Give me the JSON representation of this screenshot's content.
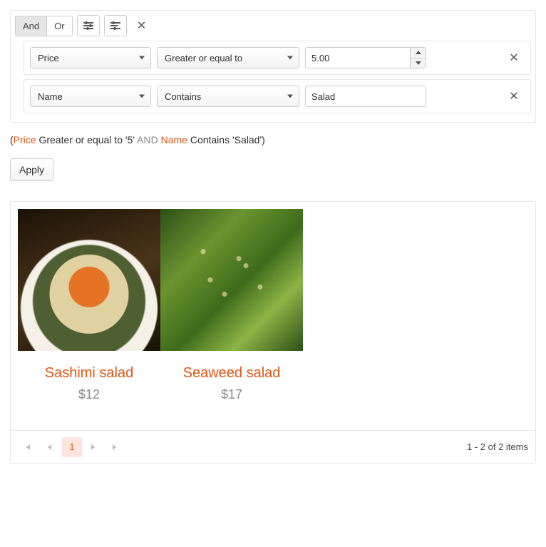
{
  "filter": {
    "logic": {
      "and": "And",
      "or": "Or",
      "active": "and"
    },
    "rules": [
      {
        "field": "Price",
        "operator": "Greater or equal to",
        "value": "5.00",
        "type": "number"
      },
      {
        "field": "Name",
        "operator": "Contains",
        "value": "Salad",
        "type": "text"
      }
    ]
  },
  "expression": {
    "open": "(",
    "field1": "Price",
    "text1": " Greater or equal to '5' ",
    "logic": "AND",
    "space": " ",
    "field2": "Name",
    "text2": " Contains 'Salad')"
  },
  "apply_label": "Apply",
  "results": [
    {
      "name": "Sashimi salad",
      "price": "$12"
    },
    {
      "name": "Seaweed salad",
      "price": "$17"
    }
  ],
  "pager": {
    "current": "1",
    "info": "1 - 2 of 2 items"
  }
}
